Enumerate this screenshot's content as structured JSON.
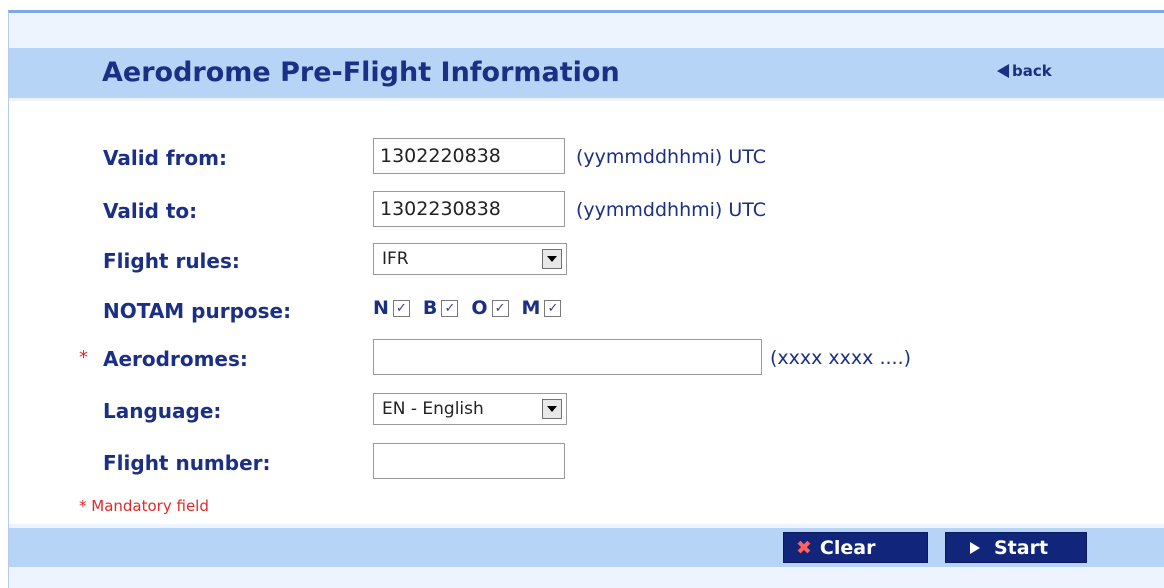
{
  "header": {
    "title": "Aerodrome Pre-Flight Information",
    "back_label": "back"
  },
  "form": {
    "valid_from": {
      "label": "Valid from:",
      "value": "1302220838",
      "hint": "(yymmddhhmi) UTC"
    },
    "valid_to": {
      "label": "Valid to:",
      "value": "1302230838",
      "hint": "(yymmddhhmi) UTC"
    },
    "flight_rules": {
      "label": "Flight rules:",
      "selected": "IFR"
    },
    "notam_purpose": {
      "label": "NOTAM purpose:",
      "options": [
        {
          "letter": "N",
          "checked": true
        },
        {
          "letter": "B",
          "checked": true
        },
        {
          "letter": "O",
          "checked": true
        },
        {
          "letter": "M",
          "checked": true
        }
      ]
    },
    "aerodromes": {
      "asterisk": "*",
      "label": "Aerodromes:",
      "value": "",
      "hint": "(xxxx xxxx ....)"
    },
    "language": {
      "label": "Language:",
      "selected": "EN - English"
    },
    "flight_number": {
      "label": "Flight number:",
      "value": ""
    },
    "mandatory_note": "* Mandatory field"
  },
  "footer": {
    "clear_label": "Clear",
    "start_label": "Start"
  },
  "icons": {
    "back": "back-arrow-icon",
    "clear": "close-icon",
    "start": "play-icon",
    "select": "chevron-down-icon",
    "check": "check-icon"
  },
  "colors": {
    "title_text": "#1b2f85",
    "band": "#b6d4f5",
    "button": "#11267a",
    "mandatory": "#e02a2a"
  }
}
